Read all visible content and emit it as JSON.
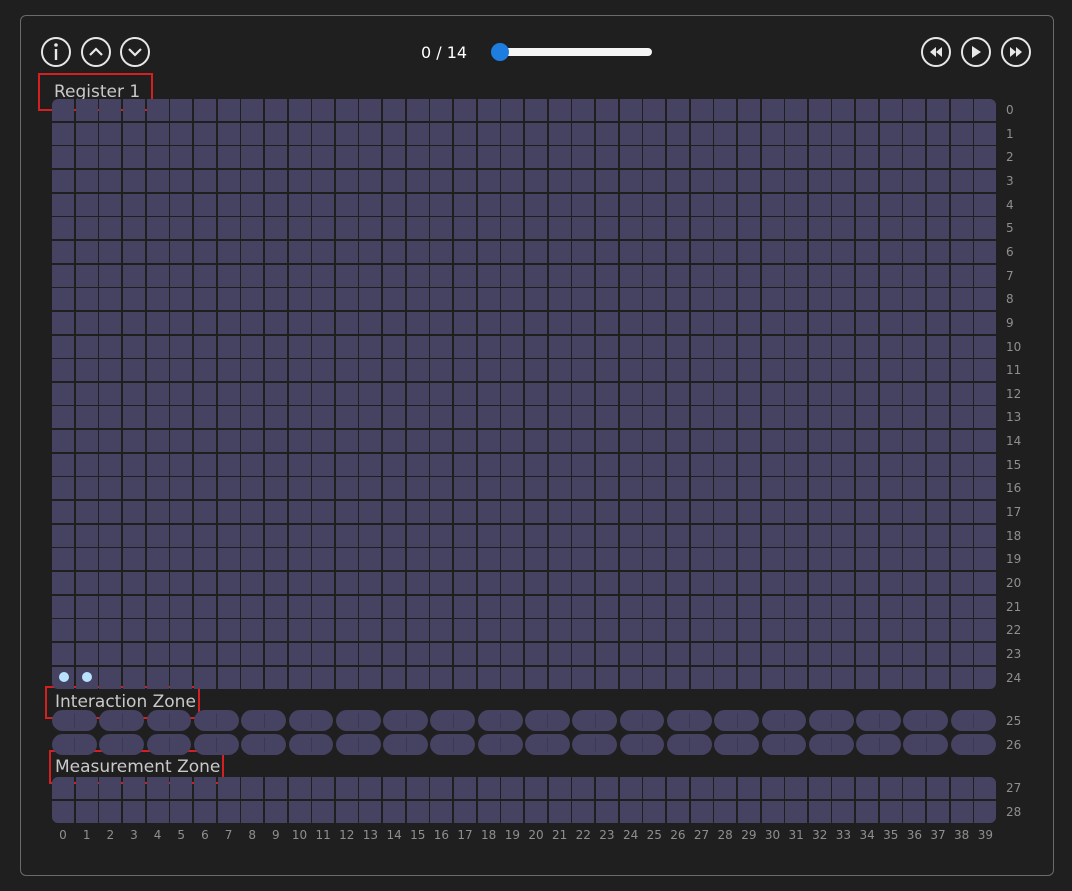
{
  "controls": {
    "info": "info-icon",
    "up": "chevron-up-icon",
    "down": "chevron-down-icon",
    "step_current": "0",
    "step_total": "14",
    "step_sep": " / ",
    "slider_fraction": 0.0,
    "rewind": "rewind-icon",
    "play": "play-icon",
    "forward": "fast-forward-icon"
  },
  "zones": {
    "register": "Register 1",
    "interaction": "Interaction Zone",
    "measurement": "Measurement Zone"
  },
  "grid": {
    "columns": 40,
    "register_rows": 25,
    "interaction_rows": [
      25,
      26
    ],
    "measurement_rows": [
      27,
      28
    ],
    "atoms": [
      {
        "row": 24,
        "col": 0
      },
      {
        "row": 24,
        "col": 1
      }
    ]
  },
  "colors": {
    "cell": "#454262",
    "atom": "#b9e2ff",
    "accent": "#1e7ee0",
    "highlight": "#d42020"
  }
}
